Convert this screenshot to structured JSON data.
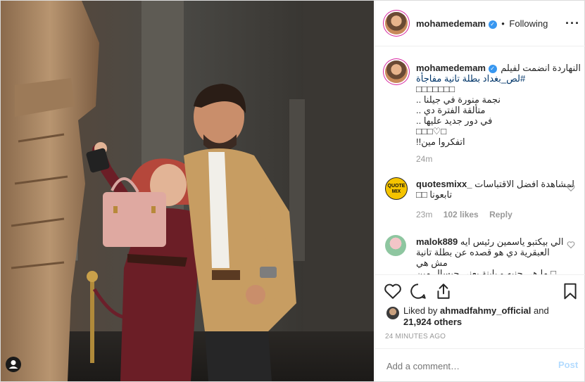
{
  "header": {
    "username": "mohamedemam",
    "separator": "•",
    "follow_label": "Following",
    "more_icon": "more-horizontal-icon"
  },
  "caption": {
    "username": "mohamedemam",
    "lines": [
      "النهاردة انضمت لفيلم",
      "#لص_بغداد بطلة تانية مفاجأة",
      "□□□□□□□",
      "نجمة منورة في جيلنا ..",
      "متألقة الفترة دي ..",
      "في دور جديد عليها ..",
      "□□□♡□",
      "اتفكروا مين!!"
    ],
    "time": "24m"
  },
  "comments": [
    {
      "username": "quotesmixx_",
      "text": "لمشاهدة افضل الاقتباسات",
      "text2": "تابعونا □□",
      "avatar_label": "QUOTE MIX",
      "time": "23m",
      "likes": "102 likes",
      "reply": "Reply"
    },
    {
      "username": "malok889",
      "text": "الي بيكتبو ياسمين رئيس ايه",
      "text2": "العبقرية دي هو قصده عن بطلة تانية مش هي",
      "text3": "□ ما هي جنبه و باينة يعني جيسال مين ليه"
    }
  ],
  "likes": {
    "prefix": "Liked by",
    "user": "ahmadfahmy_official",
    "and": "and",
    "others": "21,924 others"
  },
  "timestamp": "24 MINUTES AGO",
  "add_comment": {
    "placeholder": "Add a comment…",
    "post_label": "Post"
  },
  "colors": {
    "link": "#003569",
    "post_disabled": "#b3dbff",
    "verified": "#3897f0",
    "muted": "#999999"
  }
}
